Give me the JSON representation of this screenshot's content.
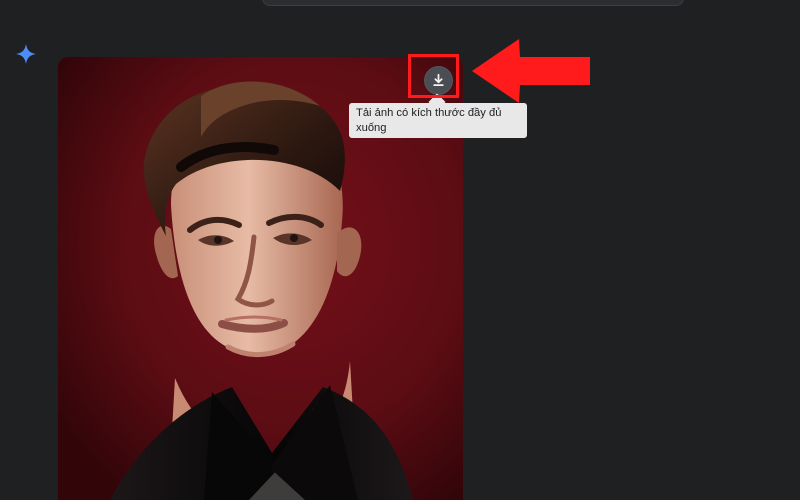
{
  "tooltip": {
    "text": "Tải ảnh có kích thước đầy đủ xuống"
  },
  "icons": {
    "assistant": "sparkle-icon",
    "download": "download-icon",
    "annotation": "red-arrow-icon"
  },
  "colors": {
    "background": "#1f2022",
    "image_background": "#7d0f18",
    "highlight": "#ff1b1b",
    "download_button": "#4a4d52",
    "tooltip_background": "#e8e8e8",
    "tooltip_text": "#202124",
    "sparkle": "#4c8df6"
  }
}
